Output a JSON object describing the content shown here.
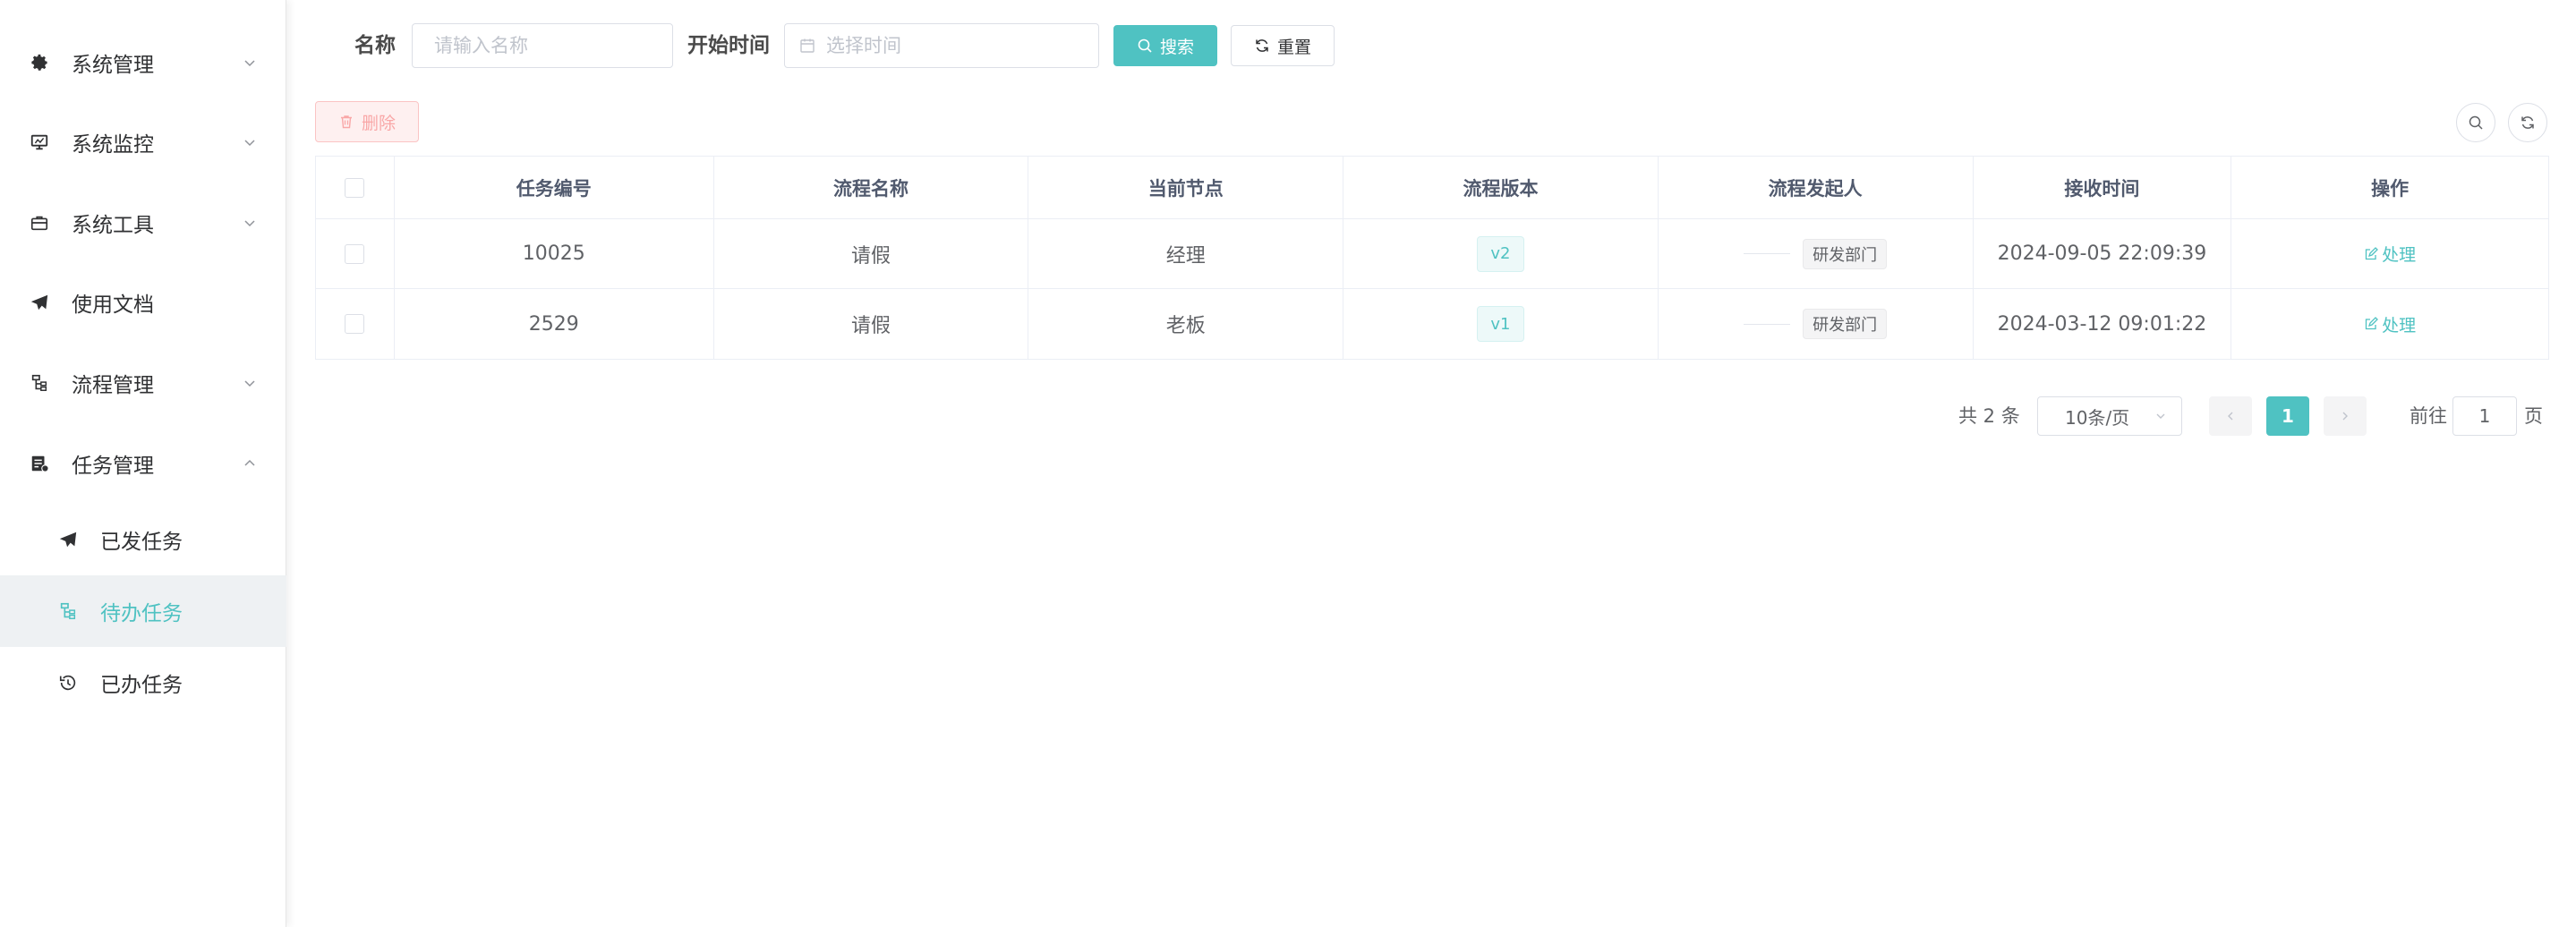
{
  "sidebar": {
    "items": [
      {
        "label": "系统管理",
        "icon": "gear-icon",
        "expanded": false
      },
      {
        "label": "系统监控",
        "icon": "monitor-icon",
        "expanded": false
      },
      {
        "label": "系统工具",
        "icon": "toolbox-icon",
        "expanded": false
      },
      {
        "label": "使用文档",
        "icon": "paper-plane-icon"
      },
      {
        "label": "流程管理",
        "icon": "flow-icon",
        "expanded": false
      },
      {
        "label": "任务管理",
        "icon": "task-icon",
        "expanded": true
      }
    ],
    "sub_items": [
      {
        "label": "已发任务",
        "icon": "paper-plane-icon",
        "active": false
      },
      {
        "label": "待办任务",
        "icon": "flow-icon",
        "active": true
      },
      {
        "label": "已办任务",
        "icon": "history-icon",
        "active": false
      }
    ]
  },
  "search": {
    "name_label": "名称",
    "name_placeholder": "请输入名称",
    "start_time_label": "开始时间",
    "start_time_placeholder": "选择时间",
    "search_button": "搜索",
    "reset_button": "重置"
  },
  "toolbar": {
    "delete_button": "删除"
  },
  "table": {
    "columns": [
      "任务编号",
      "流程名称",
      "当前节点",
      "流程版本",
      "流程发起人",
      "接收时间",
      "操作"
    ],
    "rows": [
      {
        "id": "10025",
        "process": "请假",
        "node": "经理",
        "version": "v2",
        "dept": "研发部门",
        "time": "2024-09-05 22:09:39",
        "action": "处理"
      },
      {
        "id": "2529",
        "process": "请假",
        "node": "老板",
        "version": "v1",
        "dept": "研发部门",
        "time": "2024-03-12 09:01:22",
        "action": "处理"
      }
    ]
  },
  "pagination": {
    "total_text": "共 2 条",
    "page_size": "10条/页",
    "current_page": "1",
    "goto_label": "前往",
    "goto_value": "1",
    "page_unit": "页"
  },
  "colors": {
    "primary": "#4fc2c2",
    "danger_plain": "#fef0f0"
  }
}
